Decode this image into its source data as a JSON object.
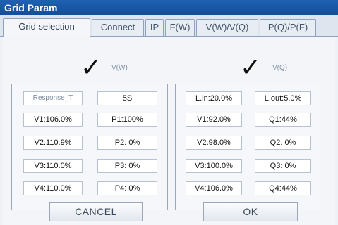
{
  "window": {
    "title": "Grid Param"
  },
  "tabs": [
    {
      "label": "Grid selection"
    },
    {
      "label": "Connect"
    },
    {
      "label": "IP"
    },
    {
      "label": "F(W)"
    },
    {
      "label": "V(W)/V(Q)"
    },
    {
      "label": "P(Q)/P(F)"
    }
  ],
  "vw": {
    "check_glyph": "✓",
    "label": "V(W)",
    "response_t_label": "Response_T",
    "response_t_value": "5S",
    "rows": [
      {
        "v": "V1:106.0%",
        "p": "P1:100%"
      },
      {
        "v": "V2:110.9%",
        "p": "P2:  0%"
      },
      {
        "v": "V3:110.0%",
        "p": "P3:  0%"
      },
      {
        "v": "V4:110.0%",
        "p": "P4:  0%"
      }
    ]
  },
  "vq": {
    "check_glyph": "✓",
    "label": "V(Q)",
    "l_in": "L.in:20.0%",
    "l_out": "L.out:5.0%",
    "rows": [
      {
        "v": "V1:92.0%",
        "q": "Q1:44%"
      },
      {
        "v": "V2:98.0%",
        "q": "Q2: 0%"
      },
      {
        "v": "V3:100.0%",
        "q": "Q3: 0%"
      },
      {
        "v": "V4:106.0%",
        "q": "Q4:44%"
      }
    ]
  },
  "buttons": {
    "cancel": "CANCEL",
    "ok": "OK"
  }
}
